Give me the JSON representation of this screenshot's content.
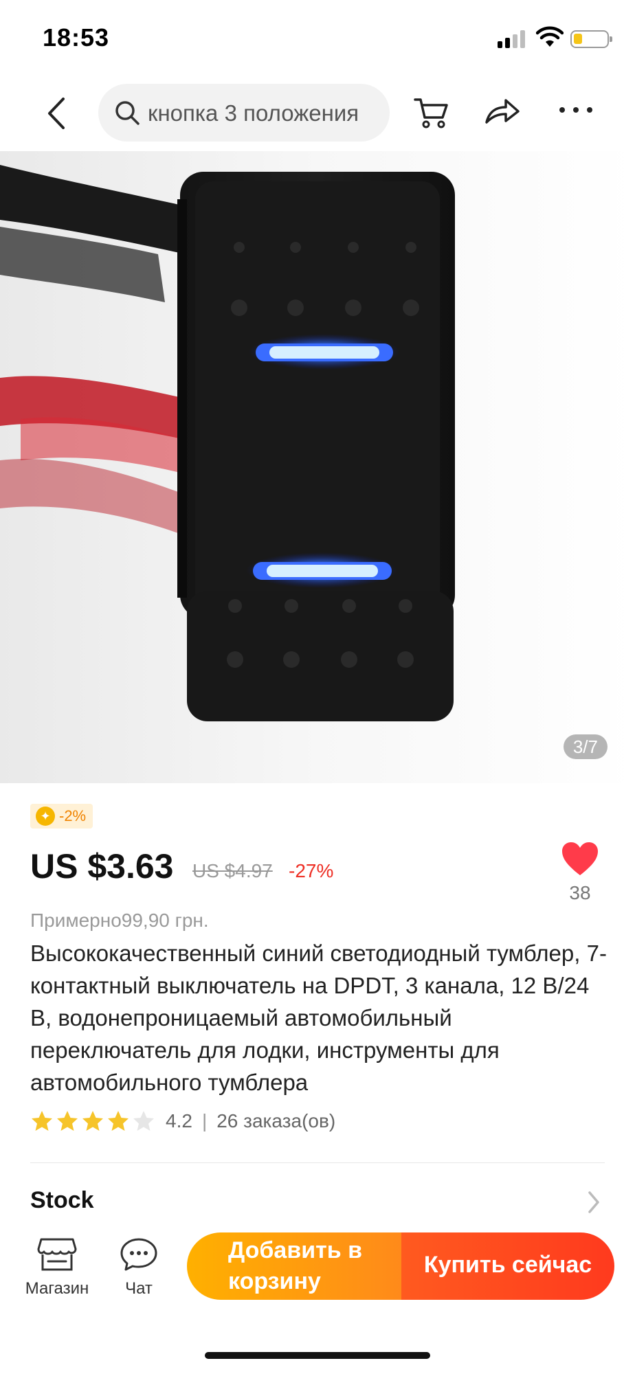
{
  "status_bar": {
    "time": "18:53"
  },
  "nav": {
    "search_text": "кнопка 3 положения",
    "icons": [
      "back-icon",
      "search-icon",
      "cart-icon",
      "share-icon",
      "more-icon"
    ]
  },
  "gallery": {
    "counter": "3/7"
  },
  "product": {
    "coupon": "-2%",
    "price": "US $3.63",
    "old_price": "US $4.97",
    "discount": "-27%",
    "wishlist_count": "38",
    "approx_price": "Примерно99,90 грн.",
    "title": "Высококачественный синий светодиодный тумблер, 7-контактный выключатель на DPDT, 3 канала, 12 В/24 В, водонепроницаемый автомобильный переключатель для лодки, инструменты для автомобильного тумблера",
    "rating": "4.2",
    "rating_fraction": 0.84,
    "orders": "26 заказа(ов)"
  },
  "stock": {
    "label": "Stock"
  },
  "bottom_bar": {
    "store_label": "Магазин",
    "chat_label": "Чат",
    "add_to_cart_label": "Добавить в корзину",
    "buy_now_label": "Купить сейчас"
  },
  "colors": {
    "price_red": "#ee2e24",
    "cart_gradient_start": "#ffb000",
    "buy_gradient": "#ff3a1e",
    "star": "#f6c42a",
    "heart": "#ff3b4a"
  }
}
